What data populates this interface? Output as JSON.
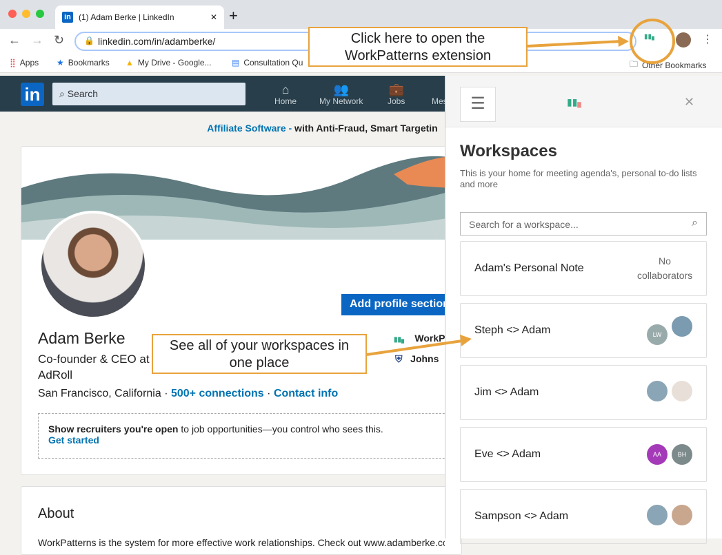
{
  "browser": {
    "tab_title": "(1) Adam Berke | LinkedIn",
    "url": "linkedin.com/in/adamberke/",
    "bookmarks": [
      "Apps",
      "Bookmarks",
      "My Drive - Google...",
      "Consultation Qu",
      "Other Bookmarks"
    ]
  },
  "linkedin": {
    "search_placeholder": "Search",
    "nav": [
      "Home",
      "My Network",
      "Jobs",
      "Mes"
    ],
    "ad_link": "Affiliate Software -",
    "ad_text": " with Anti-Fraud, Smart Targetin",
    "add_profile": "Add profile section",
    "name": "Adam Berke",
    "headline1": "Co-founder & CEO at",
    "headline2": "AdRoll",
    "location": "San Francisco, California",
    "sep": "·",
    "connections": "500+ connections",
    "contact": "Contact info",
    "experience": [
      "WorkP",
      "Johns"
    ],
    "recruiter_bold": "Show recruiters you're open",
    "recruiter_text": " to job opportunities—you control who sees this.",
    "get_started": "Get started",
    "about_title": "About",
    "about_text": "WorkPatterns is the system for more effective work relationships. Check out www.adamberke.com"
  },
  "panel": {
    "title": "Workspaces",
    "description": "This is your home for meeting agenda's, personal to-do lists and more",
    "search_placeholder": "Search for a workspace...",
    "workspaces": [
      {
        "name": "Adam's Personal Note",
        "collab": "No collaborators"
      },
      {
        "name": "Steph <> Adam",
        "avatars": [
          "LW",
          ""
        ]
      },
      {
        "name": "Jim <> Adam",
        "avatars": [
          "",
          ""
        ]
      },
      {
        "name": "Eve <> Adam",
        "avatars": [
          "AA",
          "BH"
        ]
      },
      {
        "name": "Sampson <> Adam",
        "avatars": [
          "",
          ""
        ]
      }
    ]
  },
  "annotations": {
    "callout1": "Click here to open the WorkPatterns extension",
    "callout2": "See all of your workspaces in one place"
  },
  "colors": {
    "accent": "#e8a33d",
    "linkedin_blue": "#0a66c2",
    "nav": "#283e4a"
  }
}
